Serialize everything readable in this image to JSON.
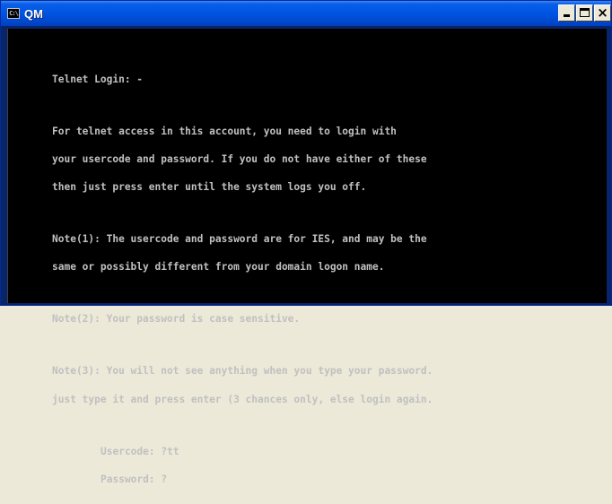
{
  "window": {
    "title": "QM",
    "app_icon_text": "C:\\",
    "close_glyph": "×"
  },
  "console": {
    "heading": "Telnet Login: -",
    "intro": [
      "For telnet access in this account, you need to login with",
      "your usercode and password. If you do not have either of these",
      "then just press enter until the system logs you off."
    ],
    "note1": [
      "Note(1): The usercode and password are for IES, and may be the",
      "same or possibly different from your domain logon name."
    ],
    "note2": "Note(2): Your password is case sensitive.",
    "note3": [
      "Note(3): You will not see anything when you type your password.",
      "just type it and press enter (3 chances only, else login again."
    ],
    "usercode_prompt": "Usercode: ?tt",
    "password_prompt": "Password: ?"
  },
  "colors": {
    "console_bg": "#000000",
    "console_text": "#c0c0c0",
    "titlebar": "#0055e3"
  }
}
